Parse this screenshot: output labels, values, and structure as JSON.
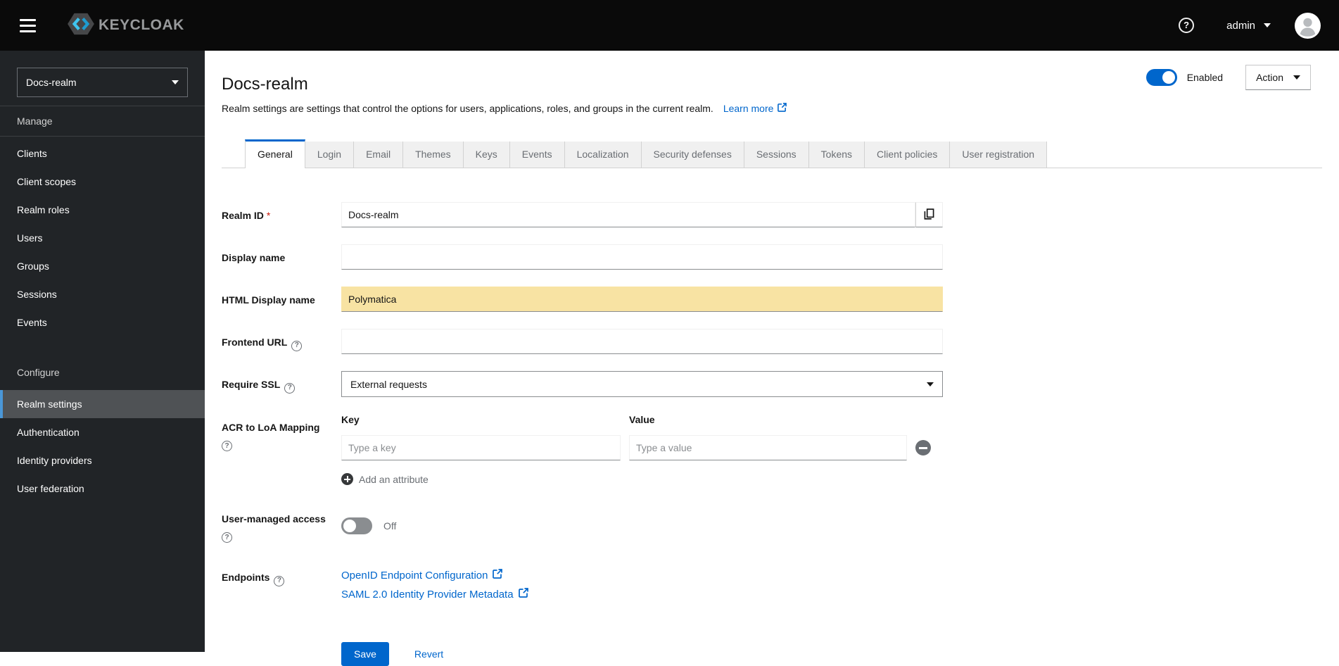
{
  "icons": {
    "question": "?"
  },
  "topbar": {
    "brand": "KEYCLOAK",
    "username": "admin"
  },
  "sidebar": {
    "realm_selector": {
      "value": "Docs-realm"
    },
    "sections": [
      {
        "label": "Manage",
        "items": [
          {
            "label": "Clients"
          },
          {
            "label": "Client scopes"
          },
          {
            "label": "Realm roles"
          },
          {
            "label": "Users"
          },
          {
            "label": "Groups"
          },
          {
            "label": "Sessions"
          },
          {
            "label": "Events"
          }
        ]
      },
      {
        "label": "Configure",
        "items": [
          {
            "label": "Realm settings",
            "active": true
          },
          {
            "label": "Authentication"
          },
          {
            "label": "Identity providers"
          },
          {
            "label": "User federation"
          }
        ]
      }
    ]
  },
  "header": {
    "title": "Docs-realm",
    "description": "Realm settings are settings that control the options for users, applications, roles, and groups in the current realm.",
    "learn_more_label": "Learn more",
    "enabled_label": "Enabled",
    "action_label": "Action"
  },
  "tabs": {
    "active": "General",
    "items": [
      {
        "label": "General"
      },
      {
        "label": "Login"
      },
      {
        "label": "Email"
      },
      {
        "label": "Themes"
      },
      {
        "label": "Keys"
      },
      {
        "label": "Events"
      },
      {
        "label": "Localization"
      },
      {
        "label": "Security defenses"
      },
      {
        "label": "Sessions"
      },
      {
        "label": "Tokens"
      },
      {
        "label": "Client policies"
      },
      {
        "label": "User registration"
      }
    ]
  },
  "form": {
    "required_marker": "*",
    "realm_id": {
      "label": "Realm ID",
      "value": "Docs-realm"
    },
    "display_name": {
      "label": "Display name",
      "value": ""
    },
    "html_display_name": {
      "label": "HTML Display name",
      "value": "Polymatica",
      "highlight_color": "#f8e3a3"
    },
    "frontend_url": {
      "label": "Frontend URL",
      "value": ""
    },
    "require_ssl": {
      "label": "Require SSL",
      "value": "External requests"
    },
    "acr_mapping": {
      "label": "ACR to LoA Mapping",
      "key_header": "Key",
      "value_header": "Value",
      "key_placeholder": "Type a key",
      "value_placeholder": "Type a value",
      "add_label": "Add an attribute"
    },
    "user_managed_access": {
      "label": "User-managed access",
      "state": "Off"
    },
    "endpoints": {
      "label": "Endpoints",
      "links": [
        {
          "label": "OpenID Endpoint Configuration"
        },
        {
          "label": "SAML 2.0 Identity Provider Metadata"
        }
      ]
    },
    "actions": {
      "save": "Save",
      "revert": "Revert"
    }
  },
  "colors": {
    "accent": "#0066cc",
    "highlight": "#f8e3a3",
    "nav_active_bar": "#4a97d8",
    "topbar_bg": "#0a0a0a"
  }
}
